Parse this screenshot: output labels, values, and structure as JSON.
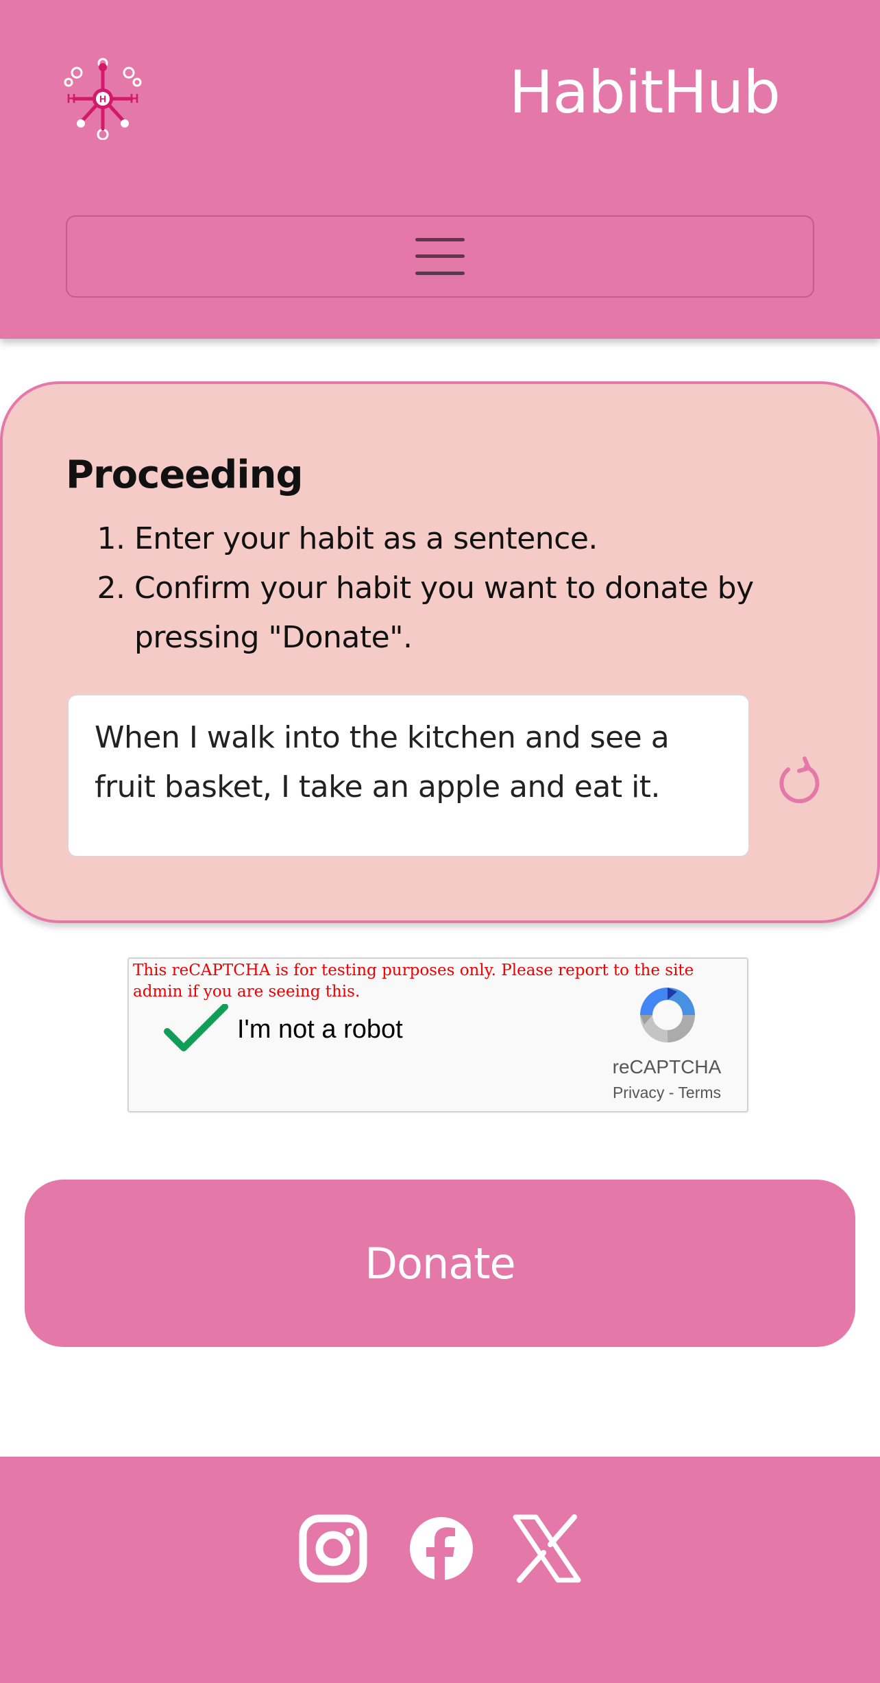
{
  "header": {
    "brand": "HabitHub",
    "logo_letter": "H",
    "menu_icon": "hamburger-menu-icon"
  },
  "card": {
    "title": "Proceeding",
    "steps": [
      "Enter your habit as a sentence.",
      "Confirm your habit you want to donate by pressing \"Donate\"."
    ],
    "habit_value": "When I walk into the kitchen and see a fruit basket, I take an apple and eat it.",
    "reset_icon": "reset-icon"
  },
  "recaptcha": {
    "warning": "This reCAPTCHA is for testing purposes only. Please report to the site admin if you are seeing this.",
    "checkbox_label": "I'm not a robot",
    "checked": true,
    "brand": "reCAPTCHA",
    "privacy": "Privacy",
    "separator": "-",
    "terms": "Terms"
  },
  "donate": {
    "label": "Donate"
  },
  "footer": {
    "social": [
      "instagram-icon",
      "facebook-icon",
      "x-icon"
    ]
  },
  "colors": {
    "primary": "#e478a9",
    "card_bg": "#f5cbc7",
    "check_green": "#0f9d58",
    "warning_red": "#ee0000"
  }
}
